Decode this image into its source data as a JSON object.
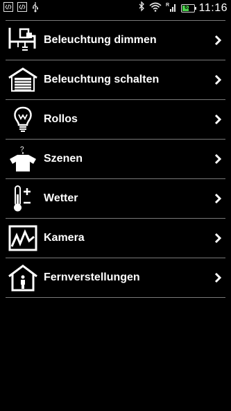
{
  "status_bar": {
    "time": "11:16",
    "battery_percent": 61,
    "battery_label": "61",
    "left_icons": [
      "code-icon",
      "code-icon",
      "usb-icon"
    ],
    "right_icons": [
      "bluetooth-icon",
      "wifi-icon",
      "signal-icon",
      "battery-icon"
    ]
  },
  "menu": {
    "items": [
      {
        "label": "Beleuchtung dimmen",
        "icon": "desk-lamp-icon"
      },
      {
        "label": "Beleuchtung schalten",
        "icon": "garage-icon"
      },
      {
        "label": "Rollos",
        "icon": "lightbulb-icon"
      },
      {
        "label": "Szenen",
        "icon": "shirt-question-icon"
      },
      {
        "label": "Wetter",
        "icon": "thermometer-icon"
      },
      {
        "label": "Kamera",
        "icon": "camera-image-icon"
      },
      {
        "label": "Fernverstellungen",
        "icon": "house-person-icon"
      }
    ]
  },
  "colors": {
    "background": "#000000",
    "text": "#ffffff",
    "divider": "#7a7a7a",
    "battery_fill": "#4ad44a"
  }
}
